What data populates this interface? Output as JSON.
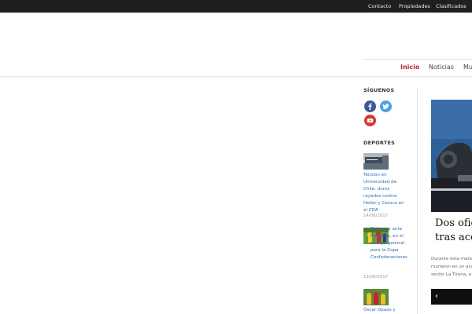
{
  "topbar": {
    "links": [
      "Contacto",
      "Propiedades",
      "Clasificados"
    ]
  },
  "nav": {
    "items": [
      {
        "label": "Inicio",
        "active": true
      },
      {
        "label": "Noticias",
        "active": false
      },
      {
        "label": "Mu",
        "active": false
      }
    ]
  },
  "sidebar": {
    "follow_title": "SÍGUENOS",
    "social": [
      "facebook-icon",
      "twitter-icon",
      "youtube-icon"
    ],
    "sports_title": "DEPORTES",
    "articles": [
      {
        "title": "Tensión en Universidad de Chile: duros rayados contra Heller y Caroca en el CDA",
        "date": "14/06/2017"
      },
      {
        "title": "Chile cae ante Rumania, en el ensayo general para la Copa Confederaciones",
        "date": "13/06/2017"
      },
      {
        "title": "Óscar Opazo y",
        "date": ""
      }
    ]
  },
  "featured": {
    "title_line1": "Dos ofic",
    "title_line2": "tras acci",
    "text_line1": "Durante esta maña",
    "text_line2": "murieron en un acc",
    "text_line3": "sector La Tirana, e",
    "prev_symbol": "‹"
  },
  "colors": {
    "topbar": "#1f1f1f",
    "accent": "#c0252a",
    "link": "#2a6db5",
    "facebook": "#3b5998",
    "twitter": "#4ba3e2",
    "youtube": "#d43a2f"
  }
}
